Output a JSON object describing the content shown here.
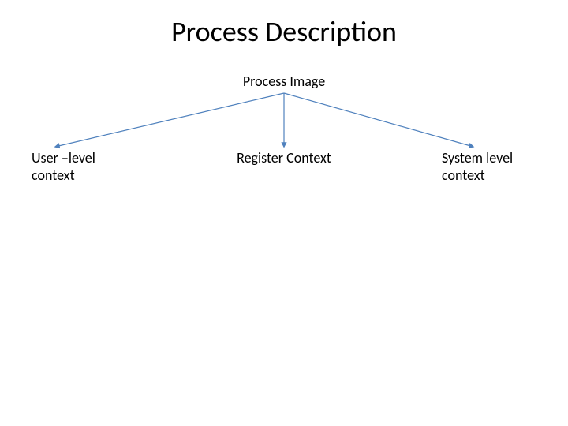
{
  "title": "Process Description",
  "root": "Process Image",
  "nodes": {
    "left": "User –level context",
    "center": "Register Context",
    "right": "System level context"
  },
  "colors": {
    "line": "#4f81bd"
  }
}
